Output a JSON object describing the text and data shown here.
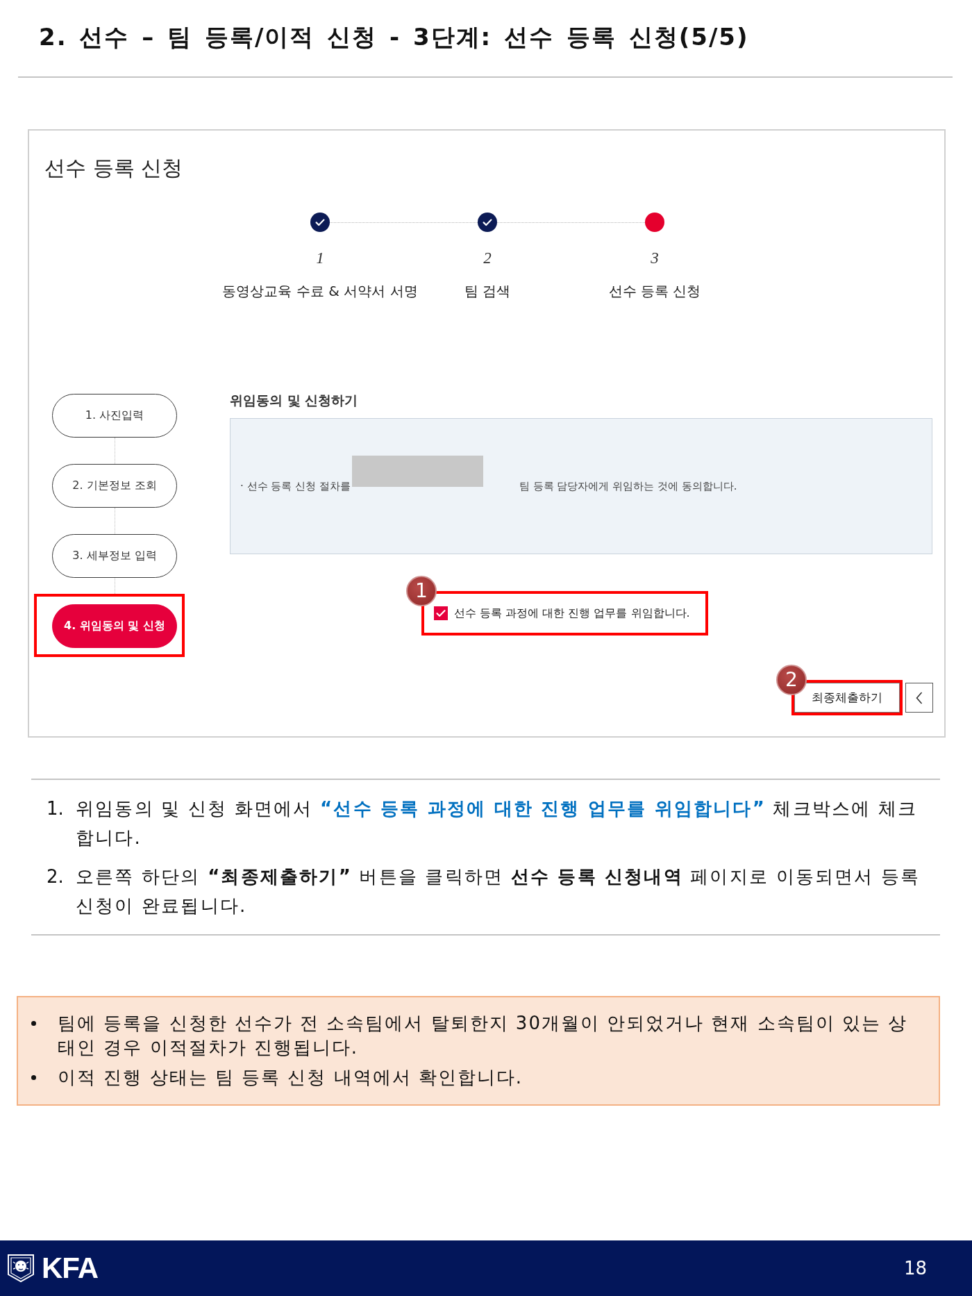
{
  "page_title": "2. 선수 – 팀 등록/이적 신청 - 3단계: 선수 등록 신청(5/5)",
  "screenshot": {
    "heading": "선수 등록 신청",
    "stepper": [
      {
        "number": "1",
        "label": "동영상교육 수료 & 서약서 서명",
        "done": true,
        "selected": false
      },
      {
        "number": "2",
        "label": "팀 검색",
        "done": true,
        "selected": false
      },
      {
        "number": "3",
        "label": "선수 등록 신청",
        "done": false,
        "selected": true
      }
    ],
    "side_steps": [
      {
        "label": "1. 사진입력",
        "selected": false,
        "highlighted": false
      },
      {
        "label": "2. 기본정보 조회",
        "selected": false,
        "highlighted": false
      },
      {
        "label": "3. 세부정보 입력",
        "selected": false,
        "highlighted": false
      },
      {
        "label": "4. 위임동의 및 신청",
        "selected": true,
        "highlighted": true
      }
    ],
    "consent": {
      "title": "위임동의 및 신청하기",
      "text_before": "· 선수 등록 신청 절차를",
      "redacted": true,
      "text_after": "팀 등록 담당자에게 위임하는 것에 동의합니다."
    },
    "agreement": {
      "label": "선수 등록 과정에 대한 진행 업무를 위임합니다.",
      "checked": true,
      "highlighted": true,
      "callout": "1"
    },
    "buttons": [
      {
        "kind": "submit",
        "label": "최종체출하기",
        "highlighted": true,
        "callout": "2"
      },
      {
        "kind": "back",
        "highlighted": false
      }
    ]
  },
  "instructions": [
    {
      "number": "1.",
      "text": "위임동의 및 신청 화면에서 **“선수 등록 과정에 대한 진행 업무를 위임합니다”** 체크박스에 체크합니다.",
      "accent": true
    },
    {
      "number": "2.",
      "text": "오른쪽 하단의 **“최종제출하기”** 버튼을 클릭하면 **선수 등록 신청내역** 페이지로 이동되면서 등록 신청이 완료됩니다.",
      "accent": false
    }
  ],
  "notes": [
    "팀에 등록을 신청한 선수가 전 소속팀에서 탈퇴한지 30개월이 안되었거나 현재 소속팀이 있는 상태인 경우 이적절차가 진행됩니다.",
    "이적 진행 상태는 팀 등록 신청 내역에서 확인합니다."
  ],
  "footer": {
    "logo_text": "KFA",
    "page_number": "18"
  }
}
